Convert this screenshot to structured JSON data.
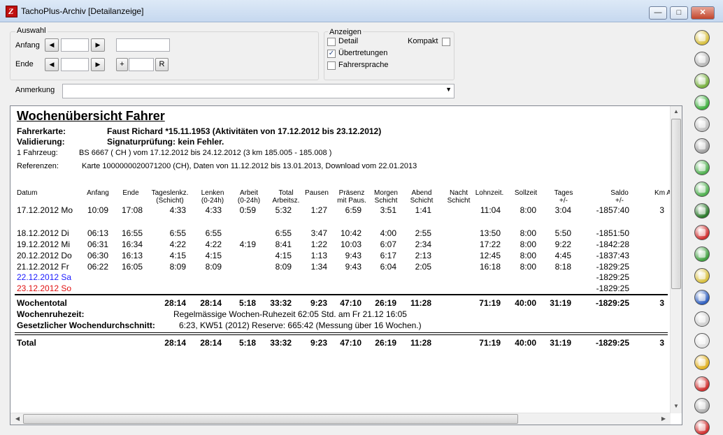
{
  "window": {
    "title": "TachoPlus-Archiv [Detailanzeige]"
  },
  "auswahl": {
    "legend": "Auswahl",
    "anfang_label": "Anfang",
    "ende_label": "Ende",
    "prev_glyph": "◀",
    "next_glyph": "▶",
    "plus_label": "+",
    "r_label": "R"
  },
  "anzeigen": {
    "legend": "Anzeigen",
    "detail_label": "Detail",
    "detail_checked": false,
    "uebertretungen_label": "Übertretungen",
    "uebertretungen_checked": true,
    "fahrersprache_label": "Fahrersprache",
    "fahrersprache_checked": false,
    "kompakt_label": "Kompakt",
    "kompakt_checked": false
  },
  "anmerkung": {
    "label": "Anmerkung",
    "value": ""
  },
  "report": {
    "title": "Wochenübersicht Fahrer",
    "fahrerkarte_label": "Fahrerkarte:",
    "fahrerkarte_value": "Faust Richard *15.11.1953  (Aktivitäten von 17.12.2012 bis 23.12.2012)",
    "validierung_label": "Validierung:",
    "validierung_value": "Signaturprüfung: kein Fehler.",
    "fahrzeug_label": "1 Fahrzeug:",
    "fahrzeug_value": "BS 6667 ( CH ) vom 17.12.2012 bis 24.12.2012 (3 km  185.005 - 185.008 )",
    "referenzen_label": "Referenzen:",
    "referenzen_value": "Karte  1000000020071200 (CH), Daten von 11.12.2012 bis 13.01.2013, Download vom 22.01.2013",
    "columns": {
      "datum": "Datum",
      "anfang": "Anfang",
      "ende": "Ende",
      "tageslenkz": "Tageslenkz.\n(Schicht)",
      "lenken": "Lenken\n(0-24h)",
      "arbeit": "Arbeit\n(0-24h)",
      "total": "Total\nArbeitsz.",
      "pausen": "Pausen",
      "praesenz": "Präsenz\nmit Paus.",
      "morgen": "Morgen\nSchicht",
      "abend": "Abend\nSchicht",
      "nacht": "Nacht\nSchicht",
      "lohnzeit": "Lohnzeit.",
      "sollzeit": "Sollzeit",
      "tages": "Tages\n+/-",
      "saldo": "Saldo\n+/-",
      "km": "Km A"
    },
    "rows": [
      {
        "datum": "17.12.2012 Mo",
        "anfang": "10:09",
        "ende": "17:08",
        "tageslenkz": "4:33",
        "lenken": "4:33",
        "arbeit": "0:59",
        "total": "5:32",
        "pausen": "1:27",
        "praesenz": "6:59",
        "morgen": "3:51",
        "abend": "1:41",
        "lohnzeit": "11:04",
        "sollzeit": "8:00",
        "tages": "3:04",
        "saldo": "-1857:40",
        "km": "3"
      },
      {
        "datum": "18.12.2012 Di",
        "anfang": "06:13",
        "ende": "16:55",
        "tageslenkz": "6:55",
        "lenken": "6:55",
        "arbeit": "",
        "total": "6:55",
        "pausen": "3:47",
        "praesenz": "10:42",
        "morgen": "4:00",
        "abend": "2:55",
        "lohnzeit": "13:50",
        "sollzeit": "8:00",
        "tages": "5:50",
        "saldo": "-1851:50",
        "km": ""
      },
      {
        "datum": "19.12.2012 Mi",
        "anfang": "06:31",
        "ende": "16:34",
        "tageslenkz": "4:22",
        "lenken": "4:22",
        "arbeit": "4:19",
        "total": "8:41",
        "pausen": "1:22",
        "praesenz": "10:03",
        "morgen": "6:07",
        "abend": "2:34",
        "lohnzeit": "17:22",
        "sollzeit": "8:00",
        "tages": "9:22",
        "saldo": "-1842:28",
        "km": ""
      },
      {
        "datum": "20.12.2012 Do",
        "anfang": "06:30",
        "ende": "16:13",
        "tageslenkz": "4:15",
        "lenken": "4:15",
        "arbeit": "",
        "total": "4:15",
        "pausen": "1:13",
        "praesenz": "9:43",
        "morgen": "6:17",
        "abend": "2:13",
        "lohnzeit": "12:45",
        "sollzeit": "8:00",
        "tages": "4:45",
        "saldo": "-1837:43",
        "km": ""
      },
      {
        "datum": "21.12.2012 Fr",
        "anfang": "06:22",
        "ende": "16:05",
        "tageslenkz": "8:09",
        "lenken": "8:09",
        "arbeit": "",
        "total": "8:09",
        "pausen": "1:34",
        "praesenz": "9:43",
        "morgen": "6:04",
        "abend": "2:05",
        "lohnzeit": "16:18",
        "sollzeit": "8:00",
        "tages": "8:18",
        "saldo": "-1829:25",
        "km": ""
      },
      {
        "datum": "22.12.2012 Sa",
        "color": "#1a1aff",
        "saldo": "-1829:25"
      },
      {
        "datum": "23.12.2012 So",
        "color": "#e01010",
        "saldo": "-1829:25"
      }
    ],
    "wochentotal": {
      "label": "Wochentotal",
      "tageslenkz": "28:14",
      "lenken": "28:14",
      "arbeit": "5:18",
      "total": "33:32",
      "pausen": "9:23",
      "praesenz": "47:10",
      "morgen": "26:19",
      "abend": "11:28",
      "lohnzeit": "71:19",
      "sollzeit": "40:00",
      "tages": "31:19",
      "saldo": "-1829:25",
      "km": "3"
    },
    "wochenruhezeit_label": "Wochenruhezeit:",
    "wochenruhezeit_value": "Regelmässige Wochen-Ruhezeit 62:05 Std. am Fr 21.12 16:05",
    "durchschnitt_label": "Gesetzlicher Wochendurchschnitt:",
    "durchschnitt_value": "6:23, KW51 (2012) Reserve:  665:42 (Messung über 16 Wochen.)",
    "total": {
      "label": "Total",
      "tageslenkz": "28:14",
      "lenken": "28:14",
      "arbeit": "5:18",
      "total": "33:32",
      "pausen": "9:23",
      "praesenz": "47:10",
      "morgen": "26:19",
      "abend": "11:28",
      "lohnzeit": "71:19",
      "sollzeit": "40:00",
      "tages": "31:19",
      "saldo": "-1829:25",
      "km": "3"
    }
  },
  "toolbar": [
    {
      "name": "open-archive-icon",
      "color": "#d8c040"
    },
    {
      "name": "list-icon",
      "color": "#b8b8b8"
    },
    {
      "name": "export-icon",
      "color": "#78b040"
    },
    {
      "name": "check-icon",
      "color": "#40b040"
    },
    {
      "name": "print-icon",
      "color": "#c0c0c0"
    },
    {
      "name": "pdf-icon",
      "color": "#a0a0a0"
    },
    {
      "name": "zoom-in-icon",
      "color": "#50b050"
    },
    {
      "name": "zoom-out-icon",
      "color": "#50b050"
    },
    {
      "name": "truck-icon",
      "color": "#2a7a2a"
    },
    {
      "name": "stop-icon",
      "color": "#d03030"
    },
    {
      "name": "recycle-icon",
      "color": "#40a040"
    },
    {
      "name": "note-icon",
      "color": "#d8c040"
    },
    {
      "name": "flag-icon",
      "color": "#3060c0"
    },
    {
      "name": "out-icon",
      "color": "#d0d0d0"
    },
    {
      "name": "no-entry-icon",
      "color": "#e0e0e0"
    },
    {
      "name": "next-icon",
      "color": "#e0b020"
    },
    {
      "name": "delete-icon",
      "color": "#d03030"
    },
    {
      "name": "save-icon",
      "color": "#b0b0b0"
    },
    {
      "name": "power-icon",
      "color": "#d03030"
    }
  ]
}
